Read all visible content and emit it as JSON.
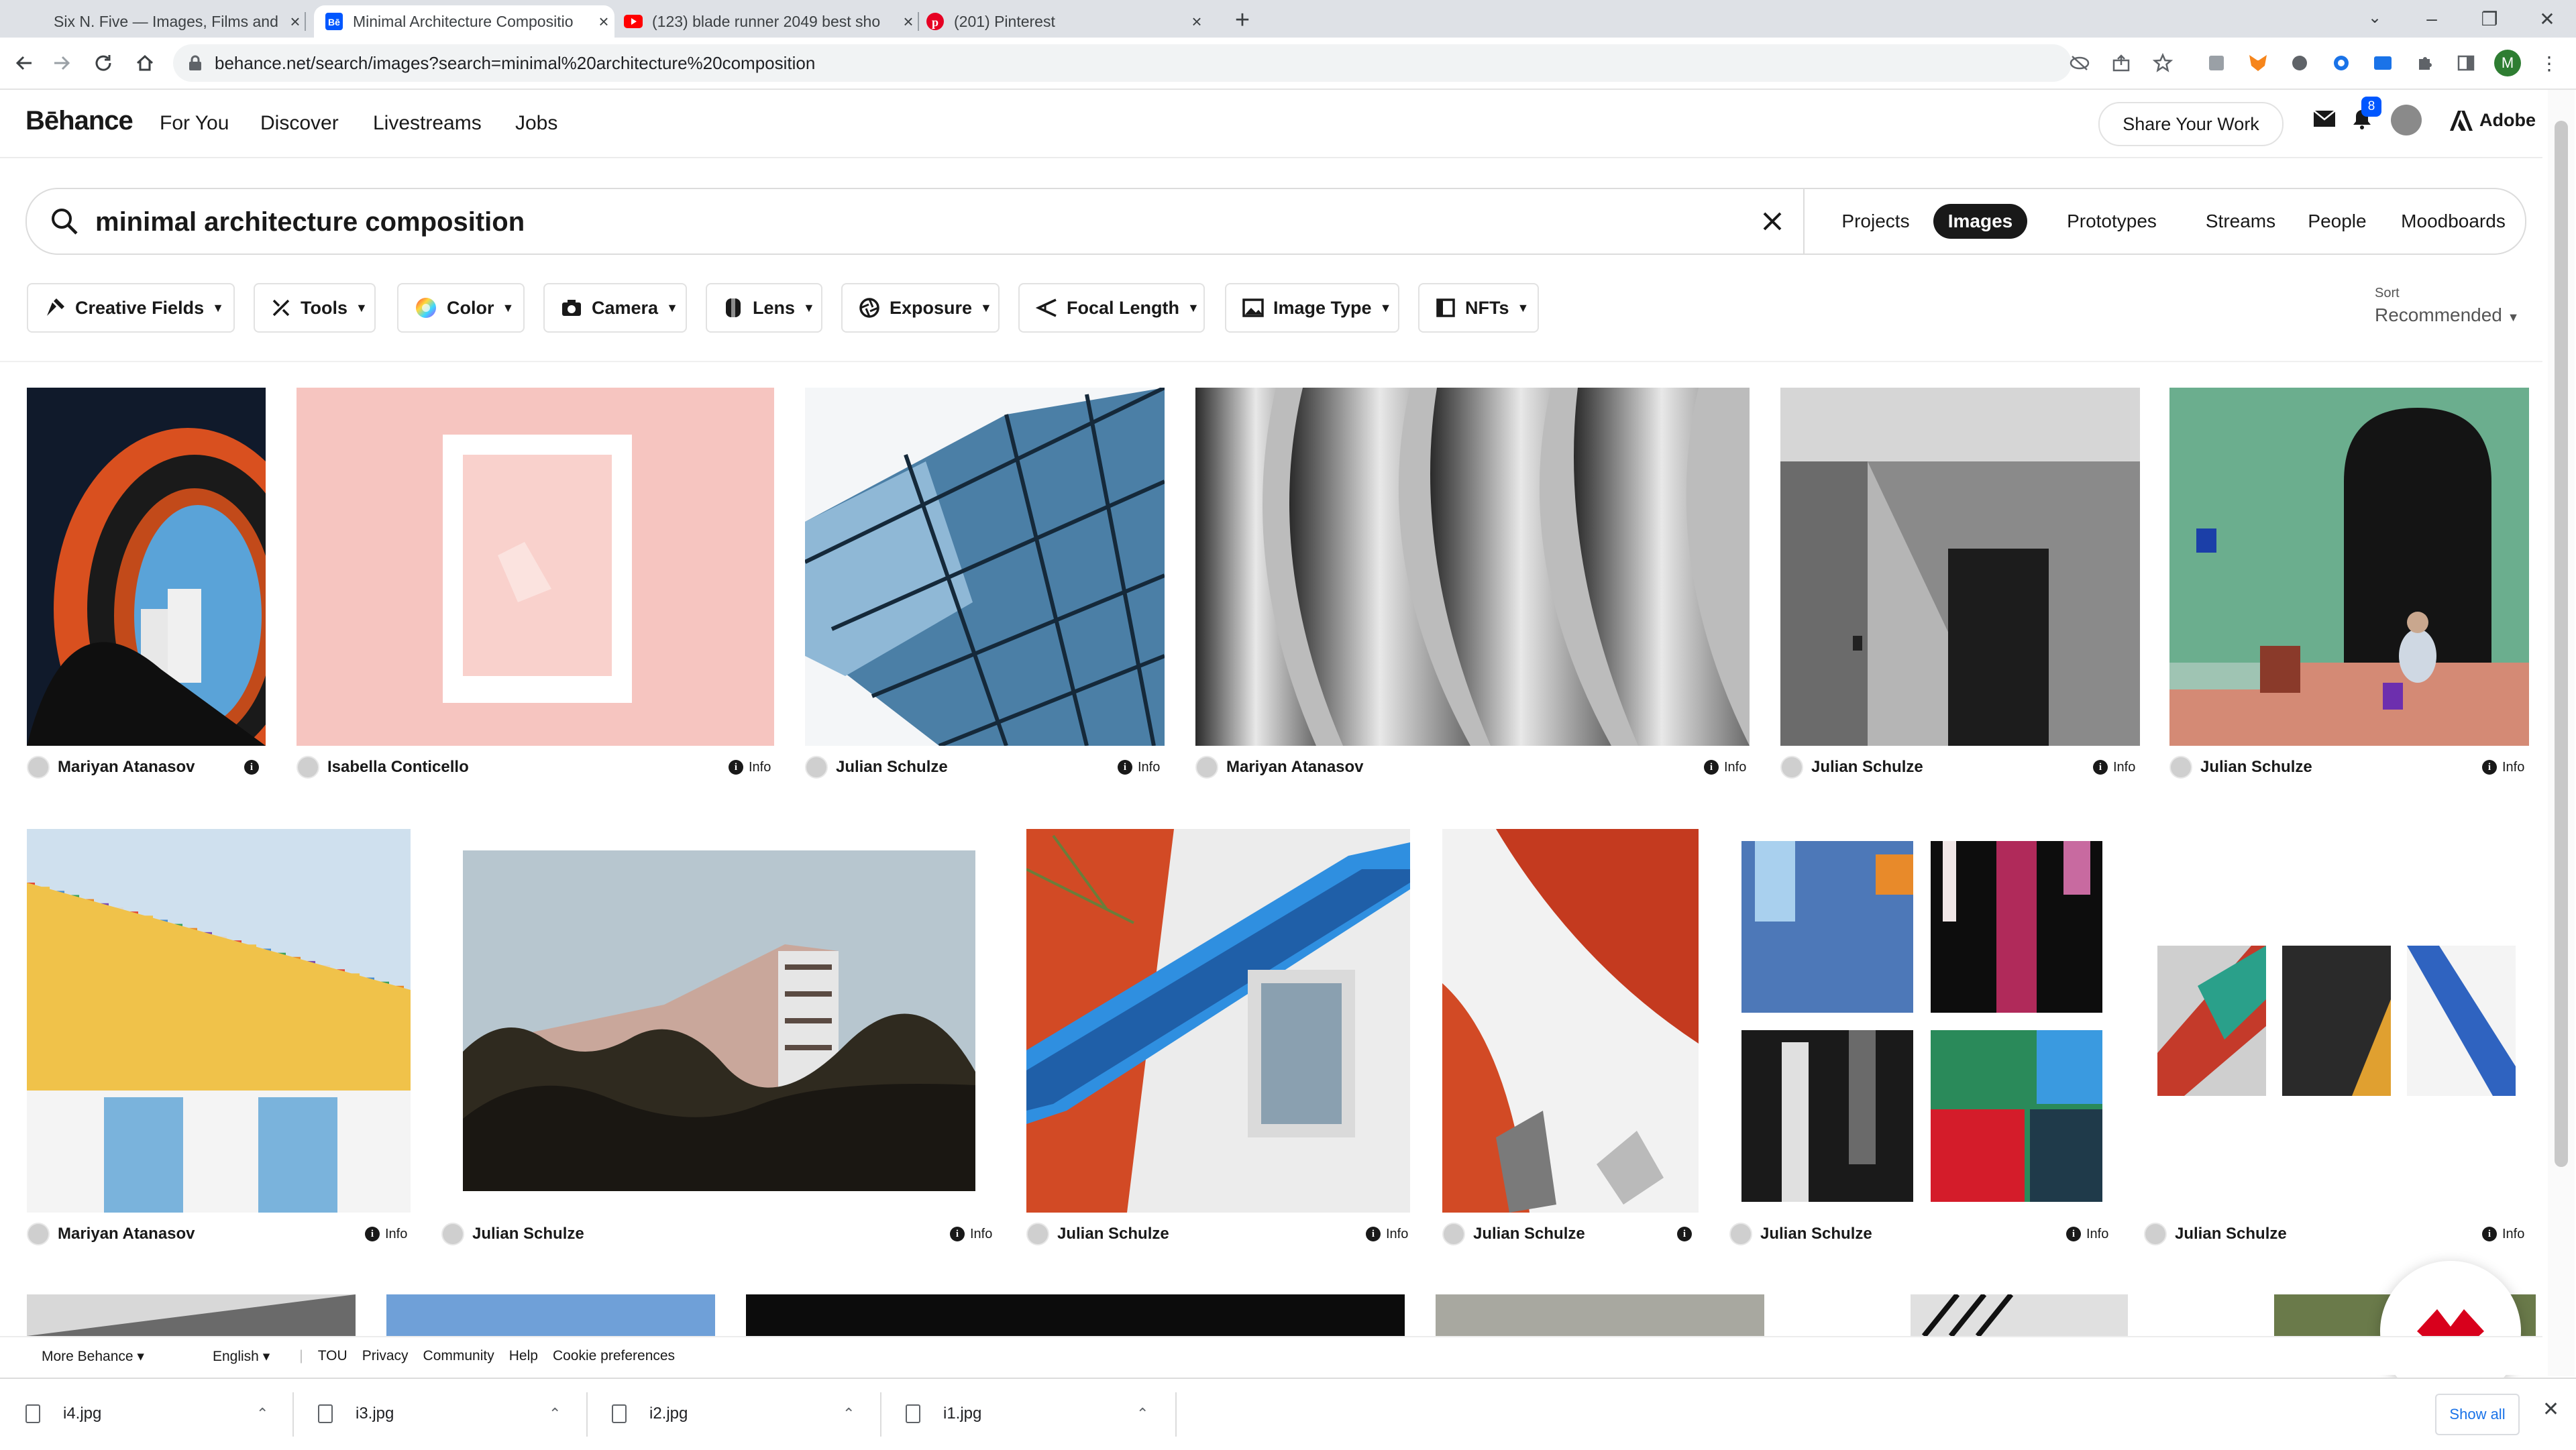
{
  "browser": {
    "tabs": [
      {
        "title": "Six N. Five — Images, Films and"
      },
      {
        "title": "Minimal Architecture Compositio"
      },
      {
        "title": "(123) blade runner 2049 best sho"
      },
      {
        "title": "(201) Pinterest"
      }
    ],
    "new_tab": "+",
    "url": "behance.net/search/images?search=minimal%20architecture%20composition",
    "profile_initial": "M"
  },
  "header": {
    "logo": "Bēhance",
    "nav": [
      "For You",
      "Discover",
      "Livestreams",
      "Jobs"
    ],
    "share_label": "Share Your Work",
    "notification_count": "8",
    "adobe_label": "Adobe"
  },
  "search": {
    "value": "minimal architecture composition",
    "tabs": [
      "Projects",
      "Images",
      "Prototypes",
      "Streams",
      "People",
      "Moodboards"
    ],
    "active_tab": "Images"
  },
  "filters": [
    "Creative Fields",
    "Tools",
    "Color",
    "Camera",
    "Lens",
    "Exposure",
    "Focal Length",
    "Image Type",
    "NFTs"
  ],
  "sort": {
    "label": "Sort",
    "value": "Recommended"
  },
  "info_label": "Info",
  "row1": [
    {
      "author": "Mariyan Atanasov"
    },
    {
      "author": "Isabella Conticello"
    },
    {
      "author": "Julian Schulze"
    },
    {
      "author": "Mariyan Atanasov"
    },
    {
      "author": "Julian Schulze"
    },
    {
      "author": "Julian Schulze"
    }
  ],
  "row2": [
    {
      "author": "Mariyan Atanasov"
    },
    {
      "author": "Julian Schulze"
    },
    {
      "author": "Julian Schulze"
    },
    {
      "author": "Julian Schulze"
    },
    {
      "author": "Julian Schulze"
    },
    {
      "author": "Julian Schulze"
    }
  ],
  "footer": {
    "more": "More Behance",
    "language": "English",
    "links": [
      "TOU",
      "Privacy",
      "Community",
      "Help",
      "Cookie preferences"
    ]
  },
  "downloads": {
    "files": [
      "i4.jpg",
      "i3.jpg",
      "i2.jpg",
      "i1.jpg"
    ],
    "show_all": "Show all"
  },
  "colors": {
    "accent_blue": "#0057ff",
    "active_tab_bg": "#191919",
    "fab_red": "#d8001c"
  }
}
